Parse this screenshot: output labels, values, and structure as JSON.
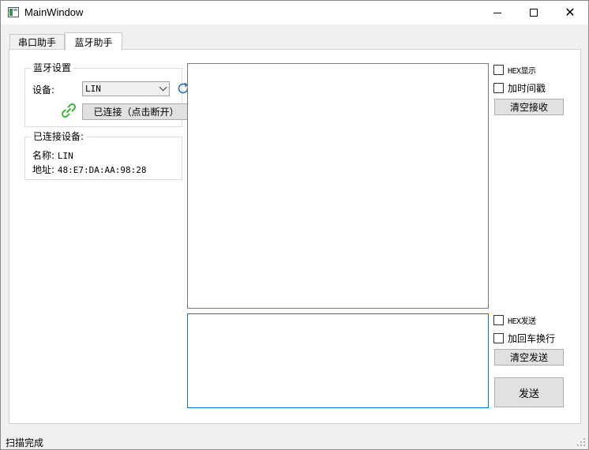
{
  "window": {
    "title": "MainWindow"
  },
  "tabs": [
    {
      "label": "串口助手",
      "active": false
    },
    {
      "label": "蓝牙助手",
      "active": true
    }
  ],
  "bluetooth_settings": {
    "group_title": "蓝牙设置",
    "device_label": "设备:",
    "device_selected": "LIN",
    "connect_button": "已连接（点击断开）"
  },
  "connected_device": {
    "group_title": "已连接设备:",
    "name_label": "名称:",
    "name_value": "LIN",
    "address_label": "地址:",
    "address_value": "48:E7:DA:AA:98:28"
  },
  "receive": {
    "hex_display_label": "HEX显示",
    "hex_display_checked": false,
    "timestamp_label": "加时间戳",
    "timestamp_checked": false,
    "clear_button": "清空接收"
  },
  "send": {
    "hex_send_label": "HEX发送",
    "hex_send_checked": false,
    "newline_label": "加回车换行",
    "newline_checked": false,
    "clear_button": "清空发送",
    "send_button": "发送"
  },
  "statusbar": {
    "text": "扫描完成"
  },
  "colors": {
    "link_icon": "#3cb43c",
    "refresh_icon": "#2a6fb8",
    "focus_border": "#0078d7"
  }
}
